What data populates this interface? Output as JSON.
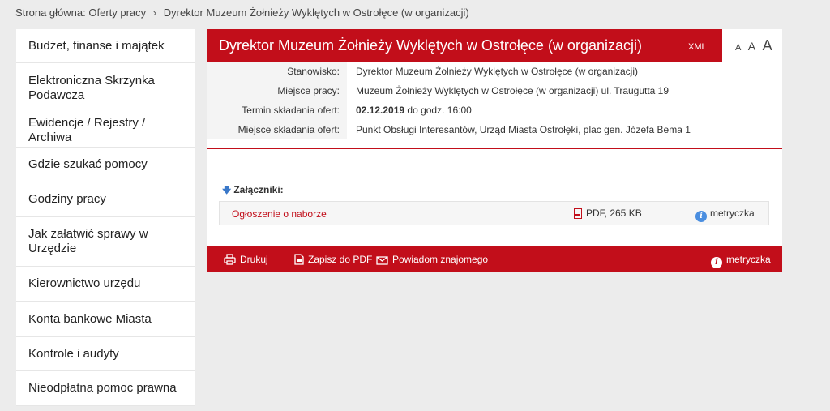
{
  "breadcrumb": {
    "home": "Strona główna:",
    "section": "Oferty pracy",
    "separator": "›",
    "current": "Dyrektor Muzeum Żołnieży Wyklętych w Ostrołęce (w organizacji)"
  },
  "sidebar": {
    "items": [
      {
        "label": "Budżet, finanse i majątek"
      },
      {
        "label": "Elektroniczna Skrzynka Podawcza"
      },
      {
        "label": "Ewidencje / Rejestry / Archiwa"
      },
      {
        "label": "Gdzie szukać pomocy"
      },
      {
        "label": "Godziny pracy"
      },
      {
        "label": "Jak załatwić sprawy w Urzędzie"
      },
      {
        "label": "Kierownictwo urzędu"
      },
      {
        "label": "Konta bankowe Miasta"
      },
      {
        "label": "Kontrole i audyty"
      },
      {
        "label": "Nieodpłatna pomoc prawna"
      }
    ]
  },
  "header": {
    "title": "Dyrektor Muzeum Żołnieży Wyklętych w Ostrołęce (w organizacji)",
    "xml_label": "XML"
  },
  "font_size": {
    "small": "A",
    "medium": "A",
    "large": "A"
  },
  "info": {
    "position_label": "Stanowisko:",
    "position_value": "Dyrektor Muzeum Żołnieży Wyklętych w Ostrołęce (w organizacji)",
    "workplace_label": "Miejsce pracy:",
    "workplace_value": "Muzeum Żołnieży Wyklętych w Ostrołęce (w organizacji) ul. Traugutta 19",
    "deadline_label": "Termin składania ofert:",
    "deadline_date": "02.12.2019",
    "deadline_time": "do godz. 16:00",
    "submission_label": "Miejsce składania ofert:",
    "submission_value": "Punkt Obsługi Interesantów, Urząd Miasta Ostrołęki, plac gen. Józefa Bema 1"
  },
  "attachments": {
    "heading": "Załączniki:",
    "items": [
      {
        "name": "Ogłoszenie o naborze",
        "format": "PDF, 265 KB",
        "meta": "metryczka"
      }
    ]
  },
  "footer": {
    "print": "Drukuj",
    "save_pdf": "Zapisz do PDF",
    "notify": "Powiadom znajomego",
    "meta": "metryczka"
  },
  "colors": {
    "accent": "#c20e1a",
    "info_icon": "#4a8ee0",
    "background": "#ececec"
  }
}
